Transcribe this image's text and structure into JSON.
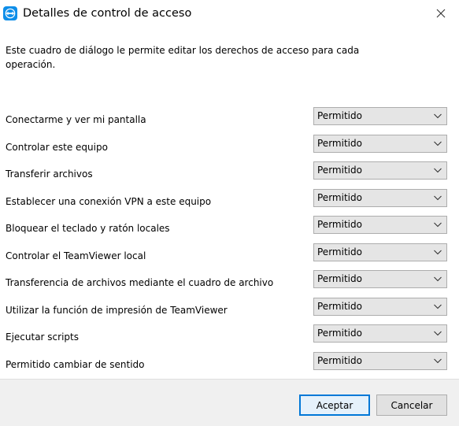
{
  "window": {
    "title": "Detalles de control de acceso",
    "icon": "teamviewer-logo-icon",
    "close_icon": "close-icon"
  },
  "description": "Este cuadro de diálogo le permite editar los derechos de acceso para cada operación.",
  "rows": [
    {
      "label": "Conectarme y ver mi pantalla",
      "value": "Permitido"
    },
    {
      "label": "Controlar este equipo",
      "value": "Permitido"
    },
    {
      "label": "Transferir archivos",
      "value": "Permitido"
    },
    {
      "label": "Establecer una conexión VPN a este equipo",
      "value": "Permitido"
    },
    {
      "label": "Bloquear el teclado y ratón locales",
      "value": "Permitido"
    },
    {
      "label": "Controlar el TeamViewer local",
      "value": "Permitido"
    },
    {
      "label": "Transferencia de archivos mediante el cuadro de archivo",
      "value": "Permitido"
    },
    {
      "label": "Utilizar la función de impresión de TeamViewer",
      "value": "Permitido"
    },
    {
      "label": "Ejecutar scripts",
      "value": "Permitido"
    },
    {
      "label": "Permitido cambiar de sentido",
      "value": "Permitido"
    }
  ],
  "buttons": {
    "accept": "Aceptar",
    "cancel": "Cancelar"
  },
  "colors": {
    "teamviewer_blue": "#0e8ee9",
    "accent": "#0078d7"
  }
}
